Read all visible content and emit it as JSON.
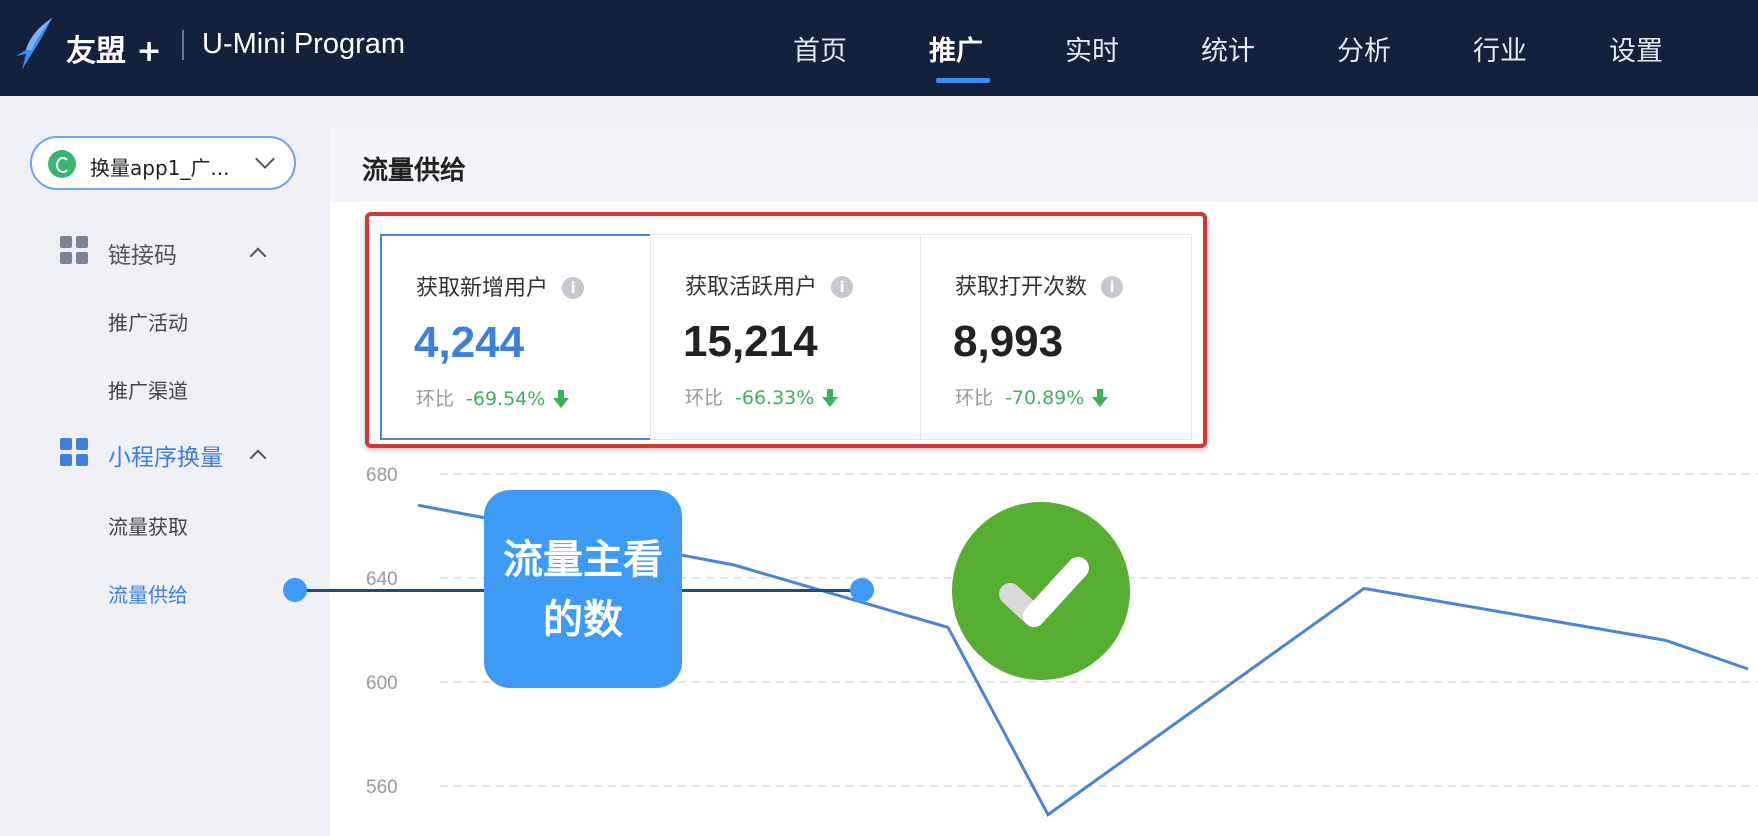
{
  "header": {
    "brand": "友盟 +",
    "product": "U-Mini Program",
    "nav": [
      "首页",
      "推广",
      "实时",
      "统计",
      "分析",
      "行业",
      "设置"
    ],
    "active_nav": "推广"
  },
  "sidebar": {
    "app_selector": "换量app1_广...",
    "groups": [
      {
        "label": "链接码",
        "items": [
          "推广活动",
          "推广渠道"
        ]
      },
      {
        "label": "小程序换量",
        "items": [
          "流量获取",
          "流量供给"
        ]
      }
    ],
    "active_item": "流量供给"
  },
  "main": {
    "title": "流量供给",
    "cards": [
      {
        "label": "获取新增用户",
        "value": "4,244",
        "compare_label": "环比",
        "change": "-69.54%"
      },
      {
        "label": "获取活跃用户",
        "value": "15,214",
        "compare_label": "环比",
        "change": "-66.33%"
      },
      {
        "label": "获取打开次数",
        "value": "8,993",
        "compare_label": "环比",
        "change": "-70.89%"
      }
    ]
  },
  "chart_data": {
    "type": "line",
    "yticks": [
      680,
      640,
      600,
      560
    ],
    "ylim": [
      540,
      680
    ],
    "series": [
      {
        "values": [
          668,
          645,
          621,
          549,
          636,
          616,
          605
        ]
      }
    ],
    "grid": true
  },
  "annotation": {
    "callout_text_1": "流量主看",
    "callout_text_2": "的数"
  },
  "colors": {
    "nav_bg": "#14213d",
    "accent_blue": "#3e7fd9",
    "highlight_red": "#d6333a",
    "positive_green": "#3fb05a",
    "check_green": "#56ae32",
    "callout_blue": "#3d9bf5"
  }
}
